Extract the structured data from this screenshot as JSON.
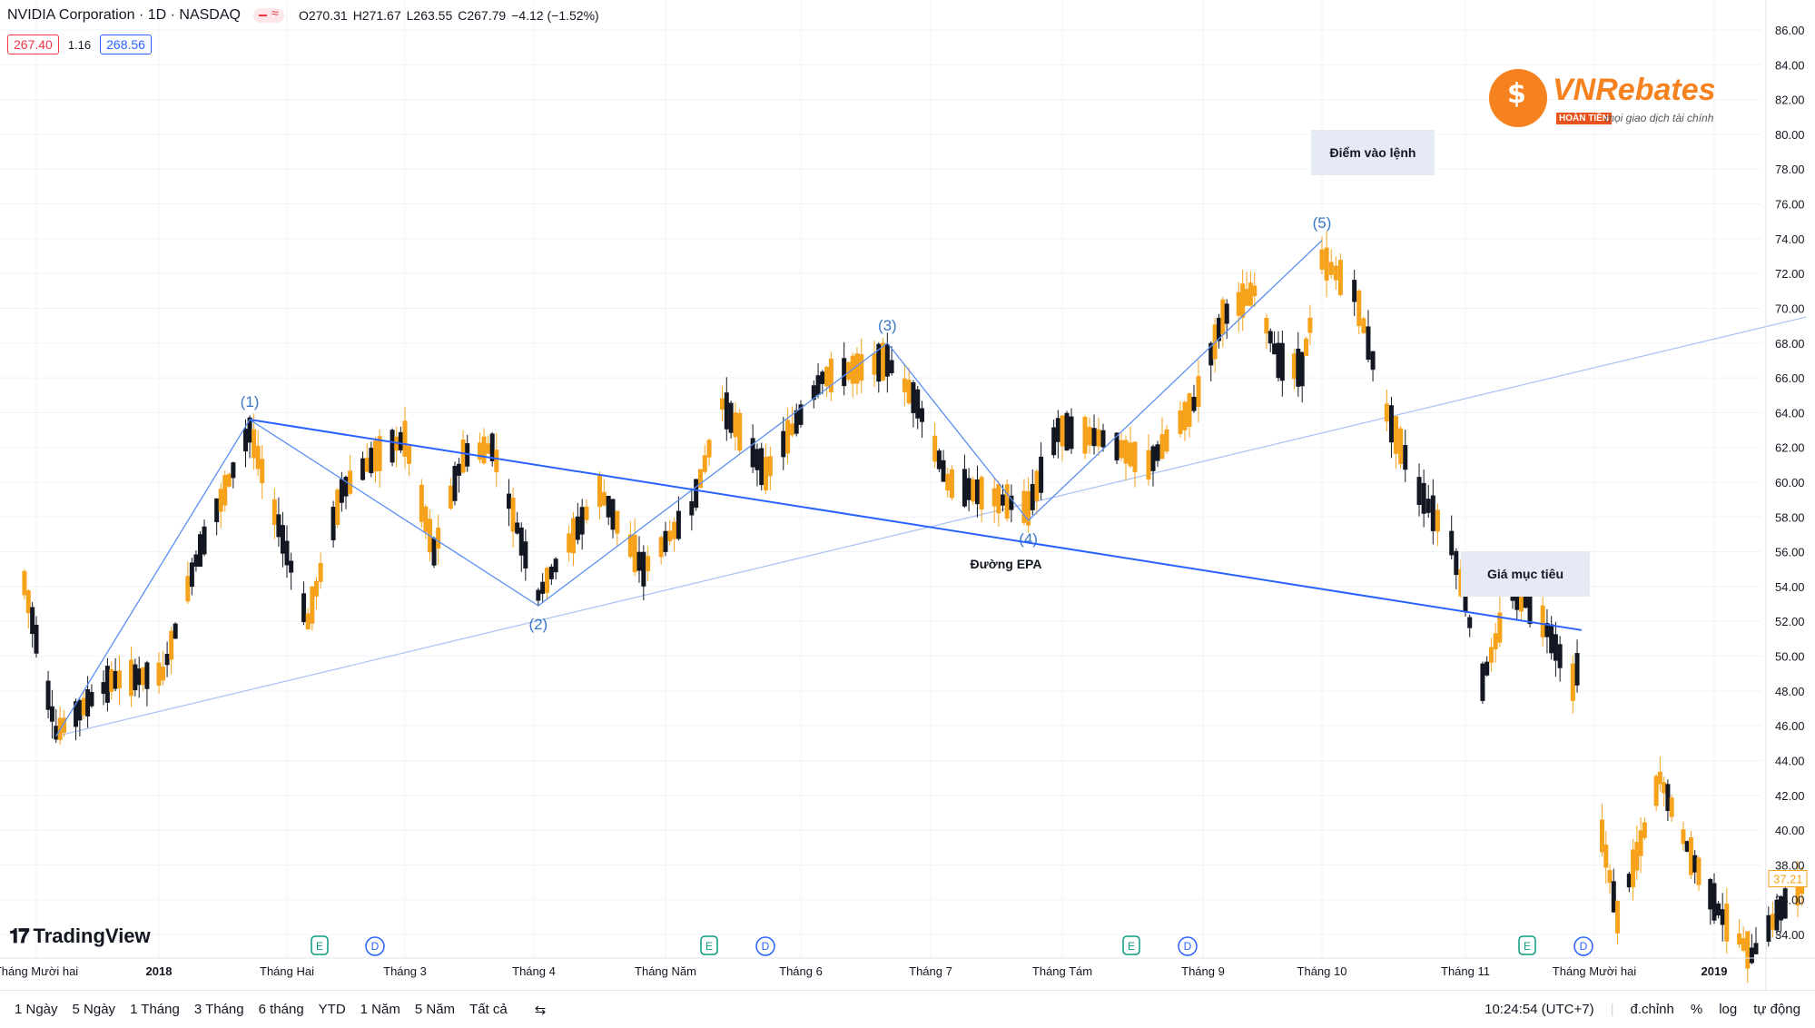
{
  "header": {
    "symbol": "NVIDIA Corporation · 1D · NASDAQ",
    "open": "O270.31",
    "high": "H271.67",
    "low": "L263.55",
    "close": "C267.79",
    "change": "−4.12 (−1.52%)",
    "bid": "267.40",
    "spread": "1.16",
    "ask": "268.56"
  },
  "brand": {
    "name": "VNRebates",
    "tag": "HOÀN TIỀN",
    "slogan": "mọi giao dịch tài chính"
  },
  "watermark": "TradingView",
  "annotations": {
    "entry_label": "Điểm vào lệnh",
    "target_label": "Giá mục tiêu",
    "epa_label": "Đường EPA",
    "wave_labels": [
      "(1)",
      "(2)",
      "(3)",
      "(4)",
      "(5)"
    ]
  },
  "price_axis": {
    "last_price": "37.21",
    "ticks": [
      "86.00",
      "84.00",
      "82.00",
      "80.00",
      "78.00",
      "76.00",
      "74.00",
      "72.00",
      "70.00",
      "68.00",
      "66.00",
      "64.00",
      "62.00",
      "60.00",
      "58.00",
      "56.00",
      "54.00",
      "52.00",
      "50.00",
      "48.00",
      "46.00",
      "44.00",
      "42.00",
      "40.00",
      "38.00",
      "36.00",
      "34.00"
    ]
  },
  "time_axis": {
    "labels": [
      "Tháng Mười hai",
      "2018",
      "Tháng Hai",
      "Tháng 3",
      "Tháng 4",
      "Tháng Năm",
      "Tháng 6",
      "Tháng 7",
      "Tháng Tám",
      "Tháng 9",
      "Tháng 10",
      "Tháng 11",
      "Tháng Mười hai",
      "2019"
    ]
  },
  "event_markers": [
    "E",
    "D",
    "E",
    "D",
    "E",
    "D",
    "E",
    "D"
  ],
  "bottom_bar": {
    "timeframes": [
      "1 Ngày",
      "5 Ngày",
      "1 Tháng",
      "3 Tháng",
      "6 tháng",
      "YTD",
      "1 Năm",
      "5 Năm",
      "Tất cả"
    ],
    "clock": "10:24:54 (UTC+7)",
    "adjust": "đ.chỉnh",
    "percent": "%",
    "log": "log",
    "auto": "tự động"
  },
  "colors": {
    "up": "#f7a21b",
    "down": "#131722",
    "trend": "#2962ff",
    "thin": "#a9c1f5"
  },
  "chart_data": {
    "type": "candlestick",
    "ylim": [
      33,
      87
    ],
    "waves": [
      {
        "label": "(1)",
        "date": "2018-01-23",
        "price": 63.6
      },
      {
        "label": "(2)",
        "date": "2018-04-02",
        "price": 52.9
      },
      {
        "label": "(3)",
        "date": "2018-06-21",
        "price": 68.0
      },
      {
        "label": "(4)",
        "date": "2018-07-24",
        "price": 57.8
      },
      {
        "label": "(5)",
        "date": "2018-10-01",
        "price": 73.9
      }
    ],
    "epa_line": [
      {
        "date": "2018-01-23",
        "price": 63.6
      },
      {
        "date": "2018-11-28",
        "price": 51.5
      }
    ],
    "thin_trendline": [
      {
        "date": "2017-12-06",
        "price": 45.4
      },
      {
        "date": "2019-01-23",
        "price": 69.5
      }
    ],
    "entry_price_marker": {
      "date": "2018-10-01",
      "price": 72.9
    },
    "target_zone": {
      "from": "2018-11-06",
      "to": "2018-11-28",
      "price": 54.0
    }
  }
}
